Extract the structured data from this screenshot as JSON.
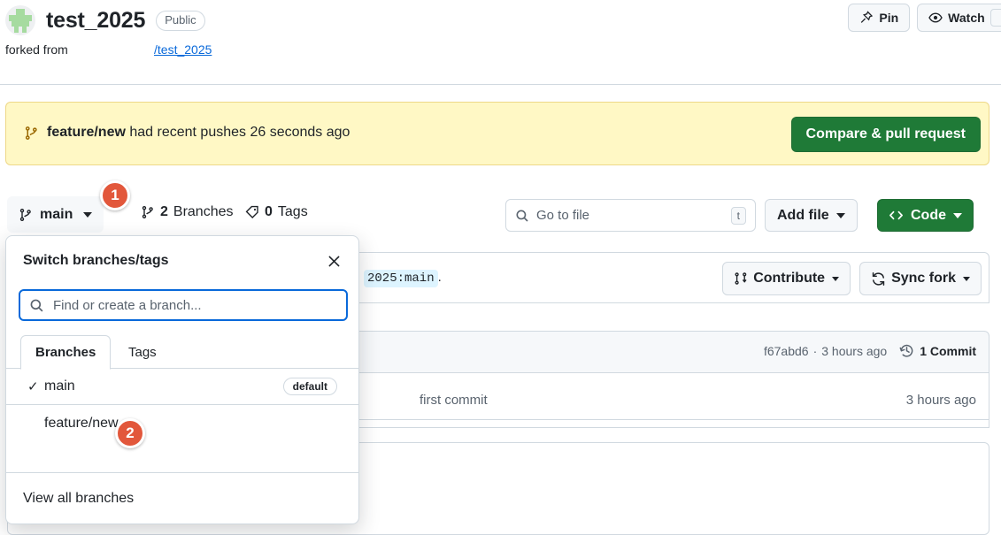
{
  "repo": {
    "name": "test_2025",
    "visibility": "Public",
    "forked_from_label": "forked from",
    "forked_from_link": "/test_2025",
    "avatar_icon": "repo-identicon-avatar"
  },
  "header_actions": {
    "pin": {
      "label": "Pin",
      "icon": "pin-icon"
    },
    "watch": {
      "label": "Watch",
      "icon": "eye-icon"
    }
  },
  "notice": {
    "icon": "branch-icon",
    "branch": "feature/new",
    "message": " had recent pushes 26 seconds ago",
    "button_label": "Compare & pull request",
    "button_color": "#1f7a37",
    "background_color": "#fff8c5"
  },
  "toolbar": {
    "branch_button": {
      "label": "main",
      "icon": "branch-icon"
    },
    "branches": {
      "count": "2",
      "label": "Branches",
      "icon": "branch-icon"
    },
    "tags": {
      "count": "0",
      "label": "Tags",
      "icon": "tag-icon"
    },
    "go_to_file": {
      "placeholder": "Go to file",
      "shortcut": "t",
      "icon": "search-icon"
    },
    "add_file": {
      "label": "Add file"
    },
    "code": {
      "label": "Code",
      "icon": "code-brackets-icon"
    }
  },
  "sync_bar": {
    "code_chip": "2025:main",
    "trailing_text": ".",
    "contribute": {
      "label": "Contribute",
      "icon": "pull-request-icon"
    },
    "sync_fork": {
      "label": "Sync fork",
      "icon": "sync-icon"
    }
  },
  "commit_bar": {
    "hash": "f67abd6",
    "separator": "·",
    "relative_time": "3 hours ago",
    "commit_count": "1 Commit",
    "history_icon": "clock-history-icon"
  },
  "files": [
    {
      "message": "first commit",
      "time": "3 hours ago"
    }
  ],
  "branch_panel": {
    "title": "Switch branches/tags",
    "close_icon": "close-icon",
    "search": {
      "placeholder": "Find or create a branch...",
      "icon": "search-icon"
    },
    "tabs": [
      {
        "label": "Branches",
        "active": true
      },
      {
        "label": "Tags",
        "active": false
      }
    ],
    "branches": [
      {
        "name": "main",
        "selected": true,
        "check": "✓",
        "badge": "default"
      },
      {
        "name": "feature/new",
        "selected": false,
        "check": "",
        "badge": ""
      }
    ],
    "footer_label": "View all branches"
  },
  "annotations": [
    {
      "number": "1",
      "target": "branch-dropdown-button",
      "color": "#e2573b"
    },
    {
      "number": "2",
      "target": "branch-list-item-feature-new",
      "color": "#e2573b"
    }
  ]
}
